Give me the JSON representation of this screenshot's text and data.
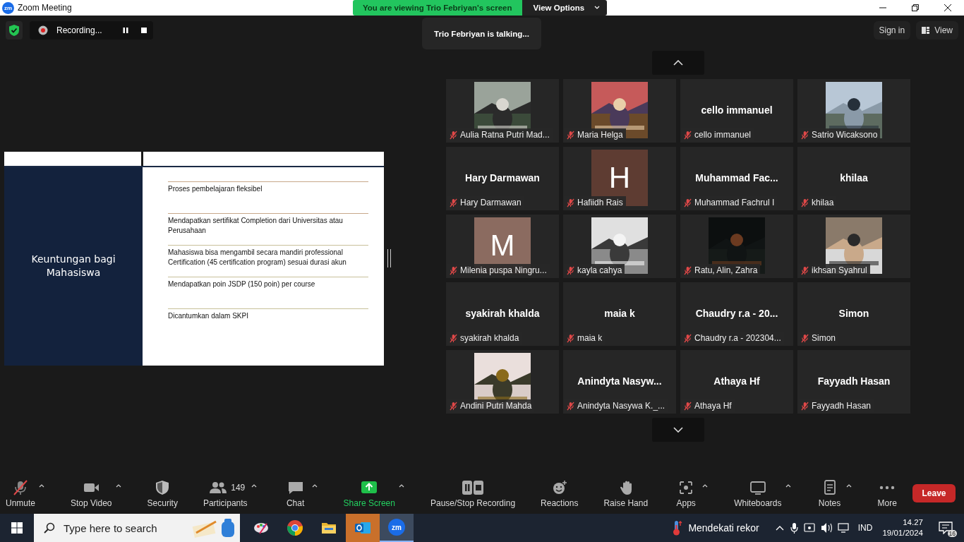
{
  "window": {
    "logo_text": "zm",
    "title": "Zoom Meeting"
  },
  "share_banner": {
    "text": "You are viewing Trio Febriyan's screen",
    "options_label": "View Options"
  },
  "recording": {
    "label": "Recording..."
  },
  "talking_toast": "Trio Febriyan is talking...",
  "top_right_buttons": [
    {
      "label": "Sign in",
      "kind": "plain"
    },
    {
      "label": "View",
      "kind": "view"
    }
  ],
  "slide": {
    "title": "Keuntungan bagi Mahasiswa",
    "bullets": [
      "Proses pembelajaran fleksibel",
      "Mendapatkan sertifikat Completion dari Universitas atau Perusahaan",
      "Mahasiswa bisa mengambil secara mandiri professional Certification (45 certification program) sesuai durasi akun",
      "Mendapatkan poin JSDP (150 poin) per course",
      "Dicantumkan dalam SKPI"
    ]
  },
  "participants": [
    {
      "name": "Aulia Ratna Putri Mad...",
      "kind": "picture",
      "muted": true
    },
    {
      "name": "Maria Helga",
      "kind": "picture",
      "muted": true
    },
    {
      "name": "cello immanuel",
      "kind": "name",
      "display": "cello immanuel",
      "muted": true
    },
    {
      "name": "Satrio Wicaksono",
      "kind": "picture",
      "muted": true
    },
    {
      "name": "Hary Darmawan",
      "kind": "name",
      "display": "Hary Darmawan",
      "muted": true
    },
    {
      "name": "Hafiidh Rais",
      "kind": "initial",
      "initial": "H",
      "color": "#5e3c32",
      "muted": true
    },
    {
      "name": "Muhammad Fachrul I",
      "kind": "name",
      "display": "Muhammad  Fac...",
      "muted": true
    },
    {
      "name": "khilaa",
      "kind": "name",
      "display": "khilaa",
      "muted": true
    },
    {
      "name": "Milenia puspa Ningru...",
      "kind": "initial",
      "initial": "M",
      "color": "#8b6b60",
      "muted": true
    },
    {
      "name": "kayla cahya",
      "kind": "picture",
      "muted": true
    },
    {
      "name": "Ratu, Alin, Zahra",
      "kind": "picture",
      "muted": true
    },
    {
      "name": "ikhsan Syahrul",
      "kind": "picture",
      "muted": true
    },
    {
      "name": "syakirah khalda",
      "kind": "name",
      "display": "syakirah khalda",
      "muted": true
    },
    {
      "name": "maia k",
      "kind": "name",
      "display": "maia k",
      "muted": true
    },
    {
      "name": "Chaudry r.a - 202304...",
      "kind": "name",
      "display": "Chaudry r.a - 20...",
      "muted": true
    },
    {
      "name": "Simon",
      "kind": "name",
      "display": "Simon",
      "muted": true
    },
    {
      "name": "Andini Putri Mahda",
      "kind": "picture",
      "muted": true
    },
    {
      "name": "Anindyta Nasywa K._...",
      "kind": "name",
      "display": "Anindyta  Nasyw...",
      "muted": true
    },
    {
      "name": "Athaya Hf",
      "kind": "name",
      "display": "Athaya Hf",
      "muted": true
    },
    {
      "name": "Fayyadh Hasan",
      "kind": "name",
      "display": "Fayyadh Hasan",
      "muted": true
    }
  ],
  "toolbar": [
    {
      "label": "Unmute",
      "kind": "mic-off",
      "caret": true
    },
    {
      "label": "Stop Video",
      "kind": "video",
      "caret": true
    },
    {
      "label": "Security",
      "kind": "shield",
      "caret": false
    },
    {
      "label": "Participants",
      "kind": "people",
      "count": "149",
      "caret": true
    },
    {
      "label": "Chat",
      "kind": "chat",
      "caret": true
    },
    {
      "label": "Share Screen",
      "kind": "share",
      "caret": true
    },
    {
      "label": "Pause/Stop Recording",
      "kind": "record",
      "caret": false
    },
    {
      "label": "Reactions",
      "kind": "smile",
      "caret": false
    },
    {
      "label": "Raise Hand",
      "kind": "hand",
      "caret": false
    },
    {
      "label": "Apps",
      "kind": "apps",
      "caret": true
    },
    {
      "label": "Whiteboards",
      "kind": "board",
      "caret": true
    },
    {
      "label": "Notes",
      "kind": "notes",
      "caret": true
    },
    {
      "label": "More",
      "kind": "more",
      "caret": false
    }
  ],
  "leave_button": "Leave",
  "taskbar": {
    "search_placeholder": "Type here to search",
    "apps": [
      {
        "kind": "paint",
        "selected": false,
        "running": false
      },
      {
        "kind": "chrome",
        "selected": false,
        "running": false
      },
      {
        "kind": "folder",
        "selected": false,
        "running": false
      },
      {
        "kind": "outlook",
        "selected": true,
        "running": false
      },
      {
        "kind": "zoom",
        "label": "zm",
        "selected": false,
        "running": true
      }
    ],
    "weather": "Mendekati rekor",
    "language": "IND",
    "time": "14.27",
    "date": "19/01/2024",
    "notifications": "16"
  }
}
